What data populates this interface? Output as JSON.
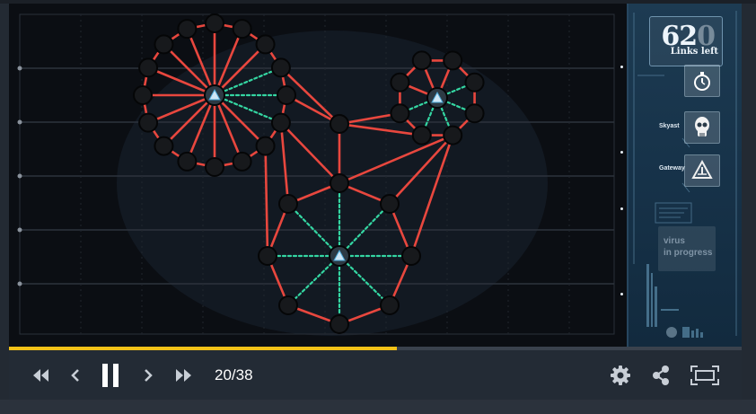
{
  "hud": {
    "links_count": "62",
    "links_faded_digit": "0",
    "links_label": "Links left",
    "tools": [
      {
        "label": "",
        "icon": "stopwatch-icon"
      },
      {
        "label": "Skyast",
        "icon": "skull-icon"
      },
      {
        "label": "Gateway",
        "icon": "gateway-icon"
      }
    ],
    "virus_text_line1": "virus",
    "virus_text_line2": "in progress"
  },
  "player": {
    "progress_percent": 53,
    "slide_counter": "20/38",
    "controls": {
      "rewind": "double-chevron-left-icon",
      "previous": "chevron-left-icon",
      "pause": "pause-icon",
      "next": "chevron-right-icon",
      "forward": "double-chevron-right-icon",
      "settings": "gear-icon",
      "share": "share-icon",
      "fullscreen": "fullscreen-icon"
    }
  },
  "colors": {
    "red_link": "#e8473e",
    "green_link": "#34d6a2",
    "node_fill": "#17191c",
    "progress": "#f2c218"
  }
}
